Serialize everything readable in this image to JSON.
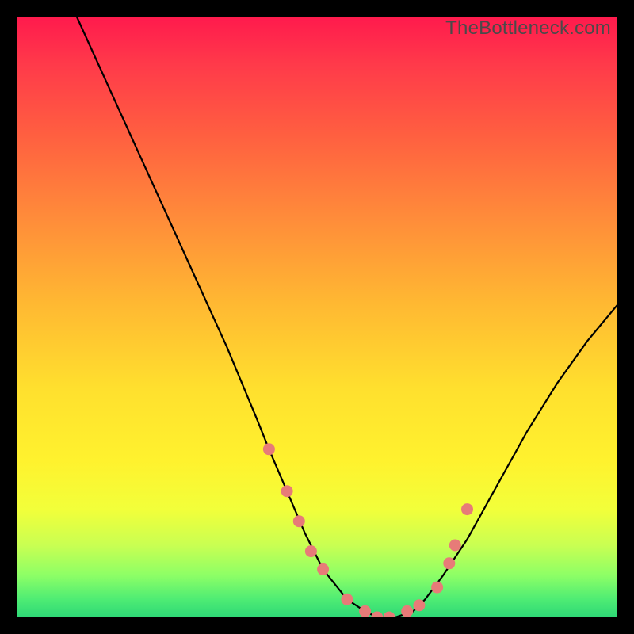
{
  "watermark": "TheBottleneck.com",
  "colors": {
    "frame": "#000000",
    "curve": "#000000",
    "marker_fill": "#e77b78",
    "marker_stroke": "#e77b78"
  },
  "chart_data": {
    "type": "line",
    "title": "",
    "xlabel": "",
    "ylabel": "",
    "xlim": [
      0,
      100
    ],
    "ylim": [
      0,
      100
    ],
    "grid": false,
    "legend": false,
    "annotations": [
      "TheBottleneck.com"
    ],
    "series": [
      {
        "name": "bottleneck-curve",
        "x": [
          10,
          15,
          20,
          25,
          30,
          35,
          40,
          42,
          45,
          48,
          51,
          55,
          58,
          60,
          63,
          66,
          68,
          71,
          75,
          80,
          85,
          90,
          95,
          100
        ],
        "y": [
          100,
          89,
          78,
          67,
          56,
          45,
          33,
          28,
          21,
          14,
          8,
          3,
          1,
          0,
          0,
          1,
          3,
          7,
          13,
          22,
          31,
          39,
          46,
          52
        ]
      }
    ],
    "markers": {
      "name": "highlight-points",
      "points": [
        {
          "x": 42,
          "y": 28
        },
        {
          "x": 45,
          "y": 21
        },
        {
          "x": 47,
          "y": 16
        },
        {
          "x": 49,
          "y": 11
        },
        {
          "x": 51,
          "y": 8
        },
        {
          "x": 55,
          "y": 3
        },
        {
          "x": 58,
          "y": 1
        },
        {
          "x": 60,
          "y": 0
        },
        {
          "x": 62,
          "y": 0
        },
        {
          "x": 65,
          "y": 1
        },
        {
          "x": 67,
          "y": 2
        },
        {
          "x": 70,
          "y": 5
        },
        {
          "x": 72,
          "y": 9
        },
        {
          "x": 73,
          "y": 12
        },
        {
          "x": 75,
          "y": 18
        }
      ]
    }
  }
}
